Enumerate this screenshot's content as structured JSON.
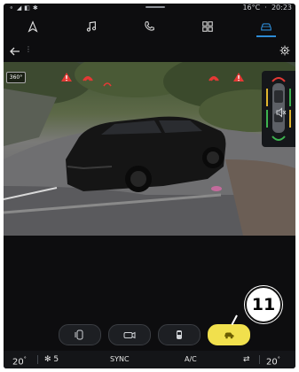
{
  "status": {
    "temperature": "16°C",
    "time": "20:23"
  },
  "nav": {
    "items": [
      {
        "name": "navigation",
        "icon": "navigation-icon"
      },
      {
        "name": "music",
        "icon": "music-icon"
      },
      {
        "name": "phone",
        "icon": "phone-icon"
      },
      {
        "name": "apps",
        "icon": "apps-icon"
      },
      {
        "name": "vehicle",
        "icon": "car-icon",
        "active": true
      }
    ],
    "accent": "#2d8bd6"
  },
  "toolbar": {
    "dots": "⋮"
  },
  "camera": {
    "view_badge": "360°",
    "warning_color": "#e53935"
  },
  "callout": {
    "number": "11"
  },
  "camera_buttons": {
    "active_color": "#f1e04d",
    "items": [
      {
        "name": "view-front-rear",
        "icon": "parking-view-icon"
      },
      {
        "name": "camera",
        "icon": "camera-icon"
      },
      {
        "name": "top-view",
        "icon": "top-view-icon"
      },
      {
        "name": "side-view",
        "icon": "side-view-icon",
        "active": true
      }
    ]
  },
  "climate": {
    "left_temp": "20",
    "left_temp_unit": "°",
    "fan_speed": "5",
    "sync_label": "SYNC",
    "ac_label": "A/C",
    "right_temp": "20",
    "right_temp_unit": "°"
  }
}
